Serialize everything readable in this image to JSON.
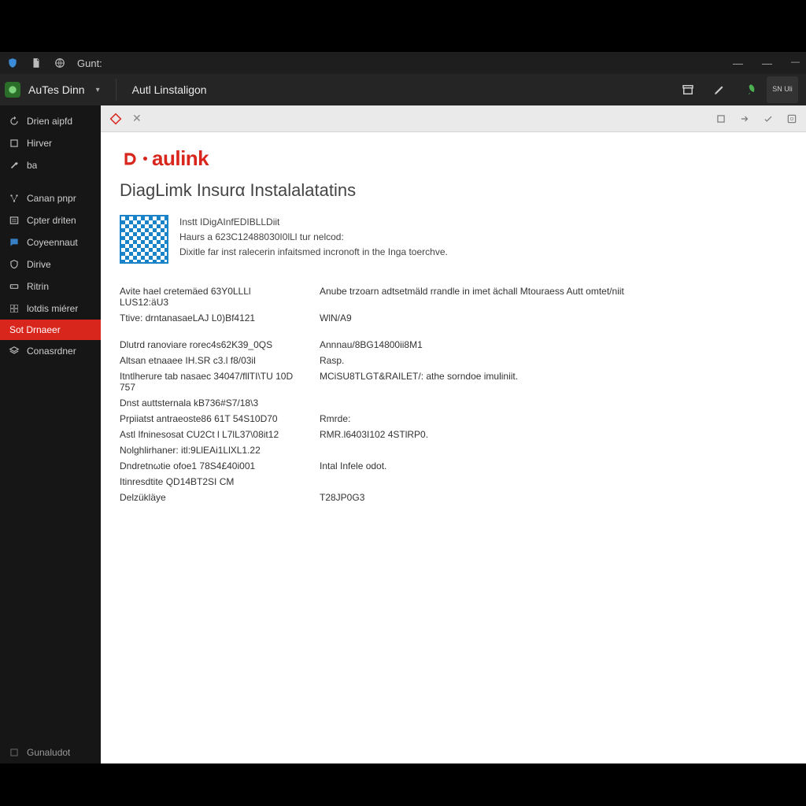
{
  "titlebar": {
    "label": "Gunt:"
  },
  "appbar": {
    "app_title": "AuTes Dinn",
    "tab_label": "Autl Linstaligon",
    "right_badge": "SN\nUli"
  },
  "sidebar": {
    "items": [
      {
        "label": "Drien aipfd"
      },
      {
        "label": "Hirver"
      },
      {
        "label": "ba"
      },
      {
        "label": "Canan pnpr"
      },
      {
        "label": "Cpter driten"
      },
      {
        "label": "Coyeennaut"
      },
      {
        "label": "Dirive"
      },
      {
        "label": "Ritrin"
      },
      {
        "label": "lotdis miérer"
      },
      {
        "label": "Sot Drnaeer"
      },
      {
        "label": "Conasrdner"
      }
    ],
    "footer": "Gunaludot"
  },
  "brand": {
    "logotext": "aulink"
  },
  "page": {
    "title": "DiagLimk Insurα Instalalatatins",
    "intro": {
      "line1": "Instt IDigAInfEDIBLLDiit",
      "line2": "Haurs a 623C12488030I0lLl tur nelcod:",
      "line3": "Dixitle far inst ralecerin infaitsmed incronoft in the Inga toerchve."
    },
    "rows": [
      {
        "k": "Avite hael cretemäed 63Y0LLLl LUS12:äU3",
        "v": "Anube trzoarn adtsetmäld rrandle in imet ächall Mtouraess Autt omtet/niit"
      },
      {
        "k": "Ttive: drntanasaeLAJ L0)Bf4121",
        "v": "WlN/A9"
      },
      {
        "gap": true
      },
      {
        "k": "Dlutrd ranoviare rorec4s62K39_0QS",
        "v": "Annnau/8BG14800ii8M1"
      },
      {
        "k": "Altsan etnaaee IH.SR c3.l f8/03il",
        "v": "Rasp."
      },
      {
        "k": "Itntlherure tab nasaec 34047/fllTI\\TU 10D 757",
        "v": "MCiSU8TLGT&RAILET/: athe sorndoe imuliniit."
      },
      {
        "k": "Dnst auttsternala kB736#S7/18\\3",
        "v": ""
      },
      {
        "k": "Prpiiatst antraeoste86 61T 54S10D70",
        "v": "Rmrde:"
      },
      {
        "k": "Astl Ifninesosat CU2Ct l L7lL37\\08it12",
        "v": "RMR.l6403I102 4STlRP0."
      },
      {
        "k": "Nolghlirhaner: itl:9LlEAi1LlXL1.22",
        "v": ""
      },
      {
        "k": "Dndretnωtie ofoe1 78S4£40i001",
        "v": "Intal Infele odot."
      },
      {
        "k": "Itinresdtite QD14BT2SI CM",
        "v": ""
      },
      {
        "k": "Delzükläye",
        "v": "T28JP0G3"
      }
    ]
  }
}
